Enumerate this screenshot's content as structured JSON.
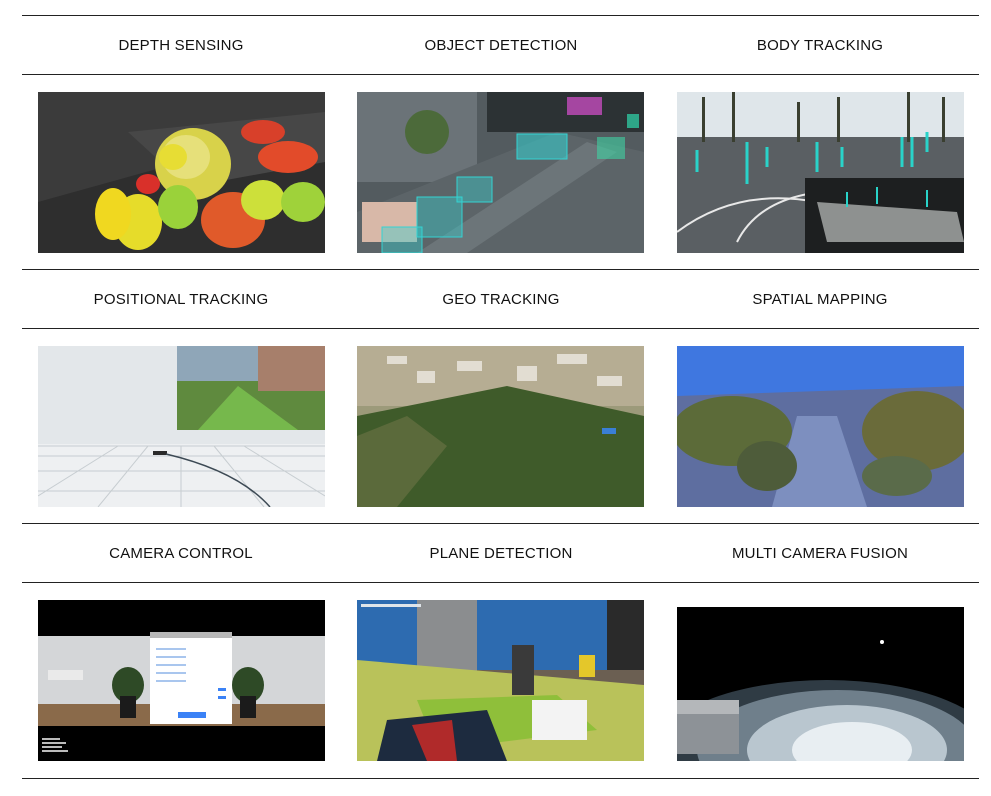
{
  "features": [
    {
      "label": "DEPTH SENSING",
      "image": "depth-sensing-image"
    },
    {
      "label": "OBJECT DETECTION",
      "image": "object-detection-image"
    },
    {
      "label": "BODY TRACKING",
      "image": "body-tracking-image"
    },
    {
      "label": "POSITIONAL TRACKING",
      "image": "positional-tracking-image"
    },
    {
      "label": "GEO TRACKING",
      "image": "geo-tracking-image"
    },
    {
      "label": "SPATIAL MAPPING",
      "image": "spatial-mapping-image"
    },
    {
      "label": "CAMERA CONTROL",
      "image": "camera-control-image"
    },
    {
      "label": "PLANE DETECTION",
      "image": "plane-detection-image"
    },
    {
      "label": "MULTI CAMERA FUSION",
      "image": "multi-camera-fusion-image"
    }
  ],
  "colors": {
    "rule": "#222222",
    "detection_box": "#34d3d3",
    "skeleton": "#29d3c9"
  }
}
